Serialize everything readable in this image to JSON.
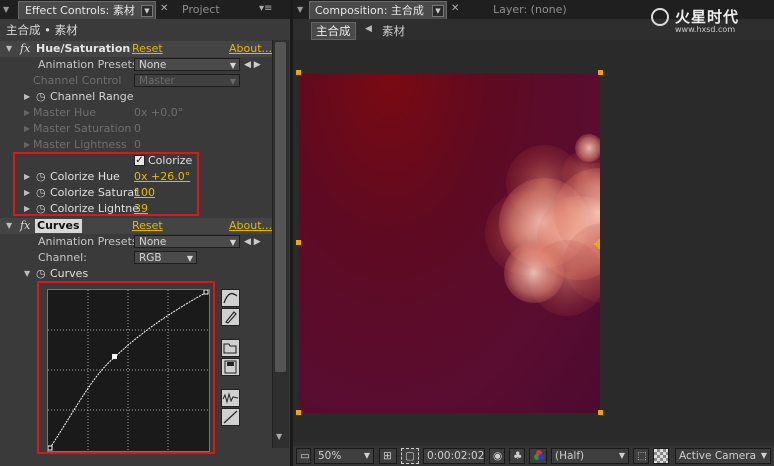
{
  "left_panel": {
    "tab_label": "Effect Controls: 素材",
    "tab2_label": "Project",
    "breadcrumb": "主合成 • 素材",
    "hue_sat": {
      "fx": "fx",
      "name": "Hue/Saturation",
      "reset": "Reset",
      "about": "About...",
      "anim_presets_label": "Animation Presets:",
      "anim_presets_value": "None",
      "channel_control_label": "Channel Control",
      "channel_control_value": "Master",
      "channel_range_label": "Channel Range",
      "master_hue_label": "Master Hue",
      "master_hue_value": "0x +0.0°",
      "master_saturation_label": "Master Saturation",
      "master_saturation_value": "0",
      "master_lightness_label": "Master Lightness",
      "master_lightness_value": "0",
      "colorize_label": "Colorize",
      "colorize_hue_label": "Colorize Hue",
      "colorize_hue_value": "0x +26.0°",
      "colorize_sat_label": "Colorize Saturat",
      "colorize_sat_value": "100",
      "colorize_light_label": "Colorize Lightne",
      "colorize_light_value": "39"
    },
    "curves": {
      "fx": "fx",
      "name": "Curves",
      "reset": "Reset",
      "about": "About...",
      "anim_presets_label": "Animation Presets:",
      "anim_presets_value": "None",
      "channel_label": "Channel:",
      "channel_value": "RGB",
      "curves_label": "Curves"
    }
  },
  "right_panel": {
    "tab_label": "Composition: 主合成",
    "layer_tab_label": "Layer: (none)",
    "comp_crumb": "主合成",
    "layer_crumb": "素材",
    "watermark_title": "火星时代",
    "watermark_url": "www.hxsd.com",
    "bottom": {
      "zoom": "50%",
      "timecode": "0:00:02:02",
      "resolution": "(Half)",
      "camera": "Active Camera"
    }
  },
  "colors": {
    "accent": "#e8b800",
    "highlight_box": "#d9181c",
    "comp_bg": "#5a0f2a"
  },
  "icons": [
    "stopwatch-icon",
    "expand-triangle-icon",
    "smooth-curve-icon",
    "pencil-icon",
    "open-folder-icon",
    "save-icon",
    "smooth-icon",
    "reset-line-icon",
    "camera-icon",
    "grid-icon",
    "anchor-point-icon"
  ]
}
